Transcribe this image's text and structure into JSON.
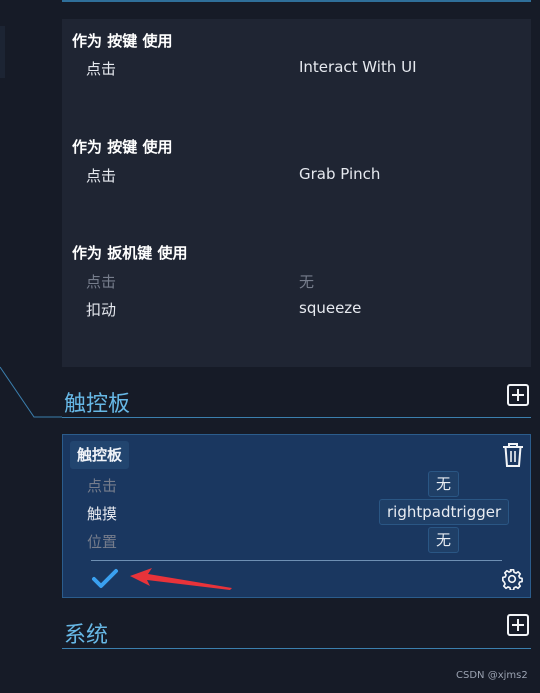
{
  "actions_card": {
    "groups": [
      {
        "title": "作为 按键 使用",
        "rows": [
          {
            "label": "点击",
            "value": "Interact With UI",
            "active": true
          }
        ]
      },
      {
        "title": "作为 按键 使用",
        "rows": [
          {
            "label": "点击",
            "value": "Grab Pinch",
            "active": true
          }
        ]
      },
      {
        "title": "作为 扳机键 使用",
        "rows": [
          {
            "label": "点击",
            "value": "无",
            "active": false
          },
          {
            "label": "扣动",
            "value": "squeeze",
            "active": true
          }
        ]
      }
    ]
  },
  "touchpad_section": {
    "title": "触控板",
    "add_icon": "plus-square-icon",
    "card": {
      "header": "触控板",
      "delete_icon": "trash-icon",
      "rows": [
        {
          "label": "点击",
          "value": "无",
          "active": false
        },
        {
          "label": "触摸",
          "value": "rightpadtrigger",
          "active": true
        },
        {
          "label": "位置",
          "value": "无",
          "active": false
        }
      ],
      "confirm_icon": "checkmark-icon",
      "settings_icon": "gear-icon"
    }
  },
  "system_section": {
    "title": "系统",
    "add_icon": "plus-square-icon"
  },
  "annotation": {
    "arrow_color": "#e8333a"
  },
  "colors": {
    "background": "#161b27",
    "card": "#1f2533",
    "accent": "#67b8e6",
    "selected_card": "#1a3760",
    "check": "#3aa0f0"
  },
  "watermark": "CSDN @xjms2"
}
